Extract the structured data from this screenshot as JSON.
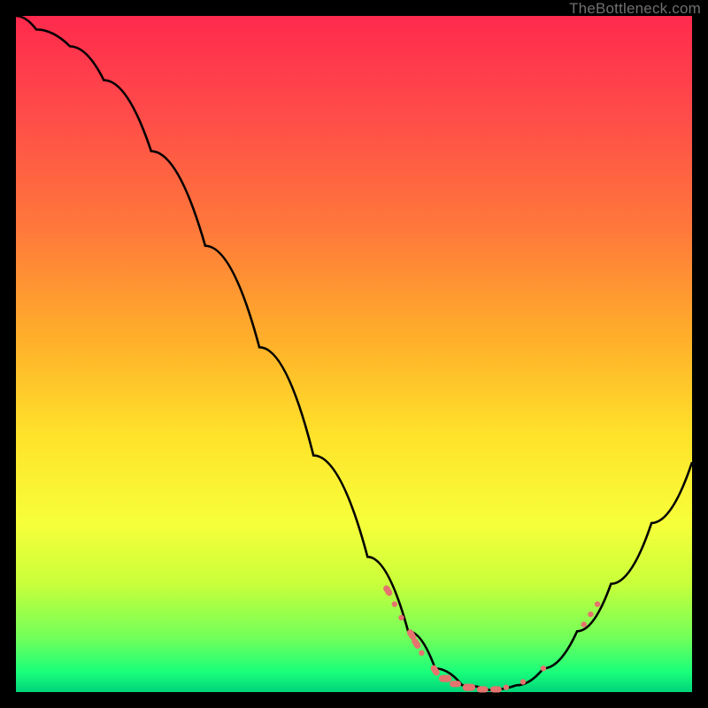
{
  "watermark": "TheBottleneck.com",
  "colors": {
    "frame": "#000000",
    "curve": "#000000",
    "marker_fill": "#e5736e",
    "marker_stroke": "#e5736e"
  },
  "chart_data": {
    "type": "line",
    "title": "",
    "xlabel": "",
    "ylabel": "",
    "xlim": [
      0,
      100
    ],
    "ylim": [
      0,
      100
    ],
    "grid": false,
    "legend": false,
    "curve": [
      {
        "x": 0,
        "y": 100
      },
      {
        "x": 3,
        "y": 98
      },
      {
        "x": 8,
        "y": 95.5
      },
      {
        "x": 13,
        "y": 90.5
      },
      {
        "x": 20,
        "y": 80
      },
      {
        "x": 28,
        "y": 66
      },
      {
        "x": 36,
        "y": 51
      },
      {
        "x": 44,
        "y": 35
      },
      {
        "x": 52,
        "y": 20
      },
      {
        "x": 58,
        "y": 9
      },
      {
        "x": 62,
        "y": 3.5
      },
      {
        "x": 66,
        "y": 1
      },
      {
        "x": 70,
        "y": 0.3
      },
      {
        "x": 74,
        "y": 1
      },
      {
        "x": 78,
        "y": 3.5
      },
      {
        "x": 83,
        "y": 9
      },
      {
        "x": 88,
        "y": 16
      },
      {
        "x": 94,
        "y": 25
      },
      {
        "x": 100,
        "y": 34
      }
    ],
    "markers": [
      {
        "x": 55,
        "y": 15,
        "r": 4,
        "shape": "pill"
      },
      {
        "x": 56,
        "y": 13,
        "r": 3.2,
        "shape": "circle"
      },
      {
        "x": 57,
        "y": 11,
        "r": 3.2,
        "shape": "circle"
      },
      {
        "x": 58.5,
        "y": 8.5,
        "r": 4,
        "shape": "pill"
      },
      {
        "x": 59.2,
        "y": 7.2,
        "r": 4,
        "shape": "pill"
      },
      {
        "x": 60,
        "y": 5.8,
        "r": 3.2,
        "shape": "circle"
      },
      {
        "x": 62,
        "y": 3.2,
        "r": 4,
        "shape": "pill"
      },
      {
        "x": 63.5,
        "y": 2,
        "r": 4.5,
        "shape": "pill"
      },
      {
        "x": 65,
        "y": 1.2,
        "r": 4,
        "shape": "pill"
      },
      {
        "x": 67,
        "y": 0.7,
        "r": 4.5,
        "shape": "pill"
      },
      {
        "x": 69,
        "y": 0.4,
        "r": 4,
        "shape": "pill"
      },
      {
        "x": 71,
        "y": 0.4,
        "r": 4,
        "shape": "pill"
      },
      {
        "x": 72.5,
        "y": 0.7,
        "r": 3.2,
        "shape": "circle"
      },
      {
        "x": 75,
        "y": 1.5,
        "r": 3.2,
        "shape": "circle"
      },
      {
        "x": 78,
        "y": 3.5,
        "r": 3.2,
        "shape": "circle"
      },
      {
        "x": 84,
        "y": 10,
        "r": 3.2,
        "shape": "circle"
      },
      {
        "x": 85,
        "y": 11.5,
        "r": 3.2,
        "shape": "circle"
      },
      {
        "x": 86,
        "y": 13,
        "r": 3.2,
        "shape": "circle"
      }
    ]
  }
}
